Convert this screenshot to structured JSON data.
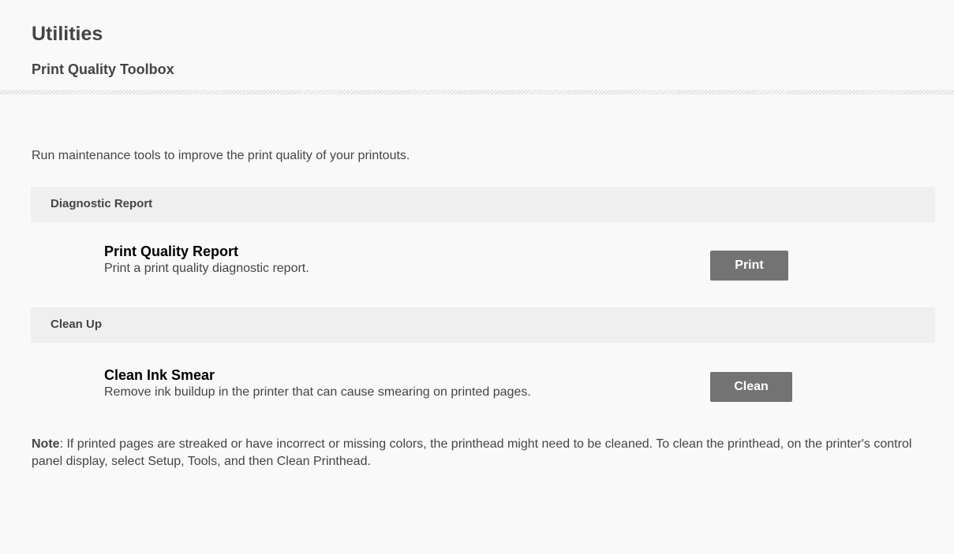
{
  "header": {
    "title": "Utilities",
    "subtitle": "Print Quality Toolbox"
  },
  "intro": "Run maintenance tools to improve the print quality of your printouts.",
  "sections": [
    {
      "heading": "Diagnostic Report",
      "item_title": "Print Quality Report",
      "item_desc": "Print a print quality diagnostic report.",
      "button_label": "Print"
    },
    {
      "heading": "Clean Up",
      "item_title": "Clean Ink Smear",
      "item_desc": "Remove ink buildup in the printer that can cause smearing on printed pages.",
      "button_label": "Clean"
    }
  ],
  "note": {
    "label": "Note",
    "text": ": If printed pages are streaked or have incorrect or missing colors, the printhead might need to be cleaned. To clean the printhead, on the printer's control panel display, select Setup, Tools, and then Clean Printhead."
  },
  "colors": {
    "background": "#f9f9f9",
    "section_bar": "#efefef",
    "button": "#737373",
    "text": "#444444"
  }
}
